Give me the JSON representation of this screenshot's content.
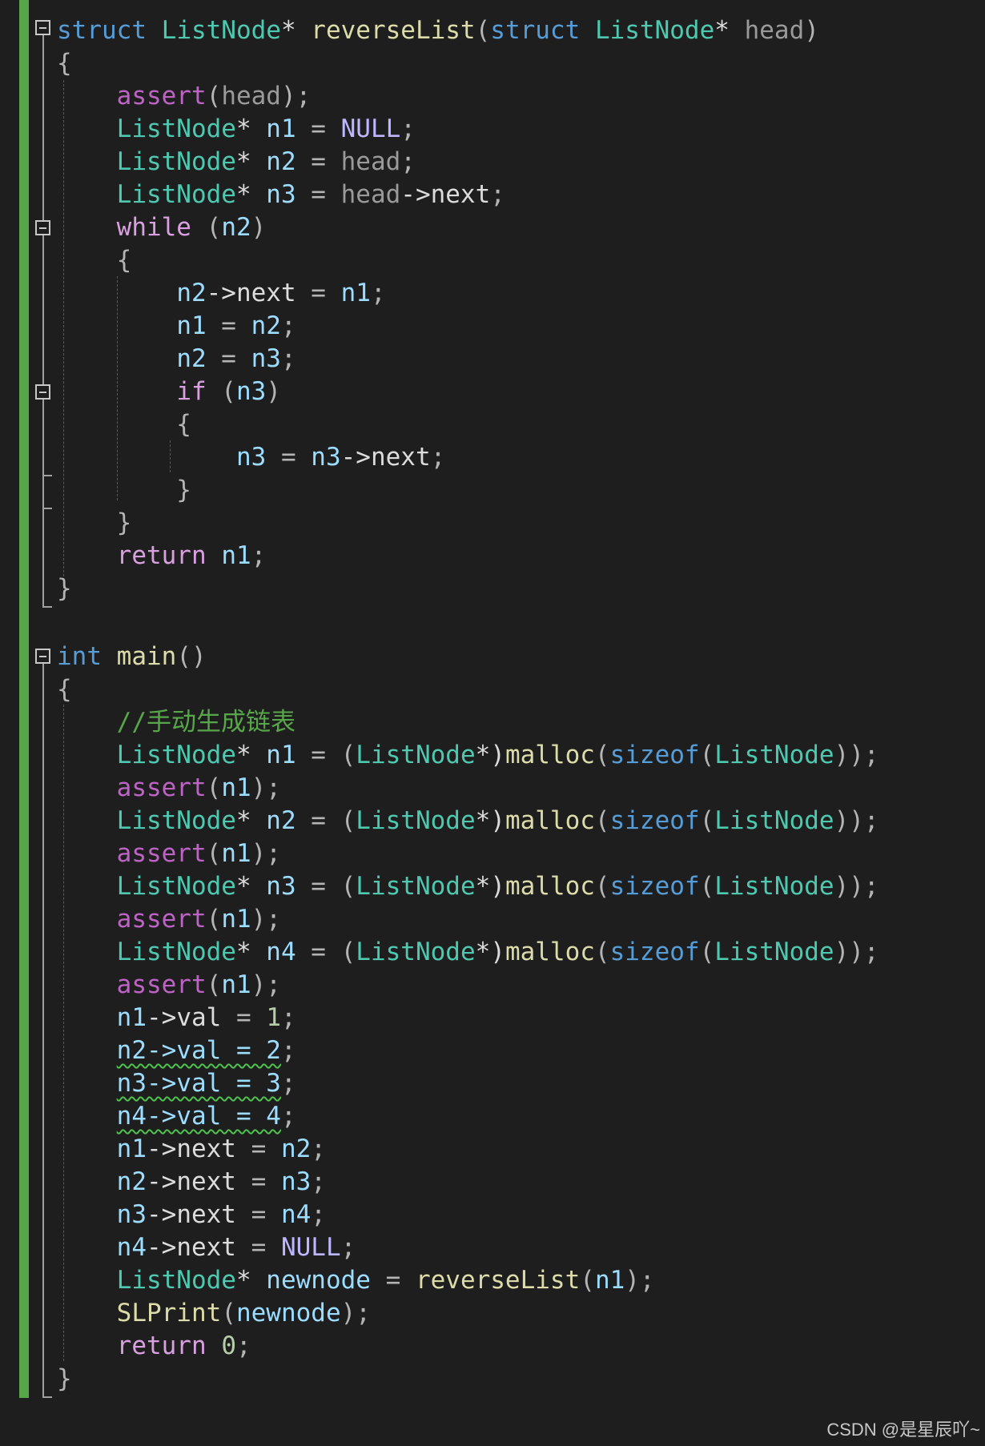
{
  "editor": {
    "lines": [
      [
        "struct",
        " ",
        "ListNode",
        "* ",
        "reverseList",
        "(",
        "struct",
        " ",
        "ListNode",
        "* ",
        "head",
        ")"
      ],
      [
        "{"
      ],
      [
        "    ",
        "assert",
        "(",
        "head",
        ");"
      ],
      [
        "    ",
        "ListNode",
        "* ",
        "n1",
        " = ",
        "NULL",
        ";"
      ],
      [
        "    ",
        "ListNode",
        "* ",
        "n2",
        " = ",
        "head",
        ";"
      ],
      [
        "    ",
        "ListNode",
        "* ",
        "n3",
        " = ",
        "head",
        "->",
        "next",
        ";"
      ],
      [
        "    ",
        "while",
        " (",
        "n2",
        ")"
      ],
      [
        "    {"
      ],
      [
        "        ",
        "n2",
        "->",
        "next",
        " = ",
        "n1",
        ";"
      ],
      [
        "        ",
        "n1",
        " = ",
        "n2",
        ";"
      ],
      [
        "        ",
        "n2",
        " = ",
        "n3",
        ";"
      ],
      [
        "        ",
        "if",
        " (",
        "n3",
        ")"
      ],
      [
        "        {"
      ],
      [
        "            ",
        "n3",
        " = ",
        "n3",
        "->",
        "next",
        ";"
      ],
      [
        "        }"
      ],
      [
        "    }"
      ],
      [
        "    ",
        "return",
        " ",
        "n1",
        ";"
      ],
      [
        "}"
      ],
      [
        ""
      ],
      [
        "int",
        " ",
        "main",
        "()"
      ],
      [
        "{"
      ],
      [
        "    ",
        "//手动生成链表"
      ],
      [
        "    ",
        "ListNode",
        "* ",
        "n1",
        " = ",
        "(",
        "ListNode",
        "*)",
        "malloc",
        "(",
        "sizeof",
        "(",
        "ListNode",
        "));"
      ],
      [
        "    ",
        "assert",
        "(",
        "n1",
        ");"
      ],
      [
        "    ",
        "ListNode",
        "* ",
        "n2",
        " = ",
        "(",
        "ListNode",
        "*)",
        "malloc",
        "(",
        "sizeof",
        "(",
        "ListNode",
        "));"
      ],
      [
        "    ",
        "assert",
        "(",
        "n1",
        ");"
      ],
      [
        "    ",
        "ListNode",
        "* ",
        "n3",
        " = ",
        "(",
        "ListNode",
        "*)",
        "malloc",
        "(",
        "sizeof",
        "(",
        "ListNode",
        "));"
      ],
      [
        "    ",
        "assert",
        "(",
        "n1",
        ");"
      ],
      [
        "    ",
        "ListNode",
        "* ",
        "n4",
        " = ",
        "(",
        "ListNode",
        "*)",
        "malloc",
        "(",
        "sizeof",
        "(",
        "ListNode",
        "));"
      ],
      [
        "    ",
        "assert",
        "(",
        "n1",
        ");"
      ],
      [
        "    ",
        "n1",
        "->",
        "val",
        " = ",
        "1",
        ";"
      ],
      [
        "    ",
        "n2->val = 2",
        ";"
      ],
      [
        "    ",
        "n3->val = 3",
        ";"
      ],
      [
        "    ",
        "n4->val = 4",
        ";"
      ],
      [
        "    ",
        "n1",
        "->",
        "next",
        " = ",
        "n2",
        ";"
      ],
      [
        "    ",
        "n2",
        "->",
        "next",
        " = ",
        "n3",
        ";"
      ],
      [
        "    ",
        "n3",
        "->",
        "next",
        " = ",
        "n4",
        ";"
      ],
      [
        "    ",
        "n4",
        "->",
        "next",
        " = ",
        "NULL",
        ";"
      ],
      [
        "    ",
        "ListNode",
        "* ",
        "newnode",
        " = ",
        "reverseList",
        "(",
        "n1",
        ");"
      ],
      [
        "    ",
        "SLPrint",
        "(",
        "newnode",
        ");"
      ],
      [
        "    ",
        "return",
        " ",
        "0",
        ";"
      ],
      [
        "}"
      ]
    ]
  },
  "watermark": "CSDN @是星辰吖~",
  "colors": {
    "background": "#1e1e1e",
    "change_bar": "#57a64a",
    "keyword": "#569cd6",
    "control": "#d8a0df",
    "type": "#4ec9b0",
    "function": "#dcdcaa",
    "variable": "#9cdcfe",
    "parameter": "#9a9a9a",
    "number": "#b5cea8",
    "comment": "#57a64a"
  }
}
